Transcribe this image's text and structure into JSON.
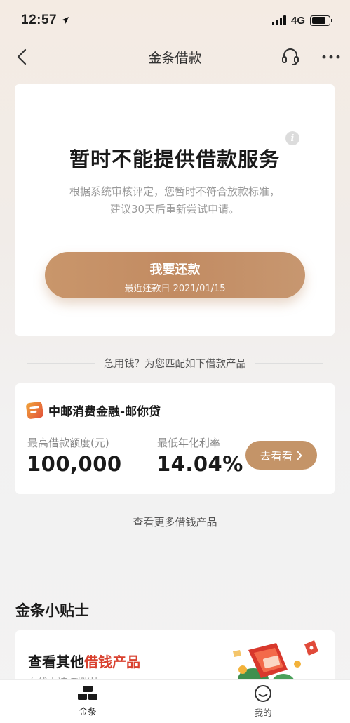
{
  "status_bar": {
    "time": "12:57",
    "network": "4G"
  },
  "nav": {
    "title": "金条借款"
  },
  "status_card": {
    "title": "暂时不能提供借款服务",
    "desc_line1": "根据系统审核评定，您暂时不符合放款标准，",
    "desc_line2": "建议30天后重新尝试申请。",
    "info_glyph": "i",
    "repay_label": "我要还款",
    "repay_sub": "最近还款日 2021/01/15"
  },
  "recommend": {
    "divider_text": "急用钱？为您匹配如下借款产品"
  },
  "product": {
    "name": "中邮消费金融-邮你贷",
    "max_label": "最高借款额度(元)",
    "max_value": "100,000",
    "rate_label": "最低年化利率",
    "rate_value": "14.04%",
    "button_label": "去看看"
  },
  "more_link": "查看更多借钱产品",
  "tips": {
    "section_title": "金条小贴士",
    "heading_prefix": "查看其他",
    "heading_highlight": "借钱产品",
    "sub": "在线申请 到账快"
  },
  "tabs": [
    {
      "label": "金条",
      "icon": "gold-bars-icon",
      "active": true
    },
    {
      "label": "我的",
      "icon": "smile-icon",
      "active": false
    }
  ],
  "colors": {
    "accent": "#c49468",
    "highlight": "#d9412f"
  }
}
